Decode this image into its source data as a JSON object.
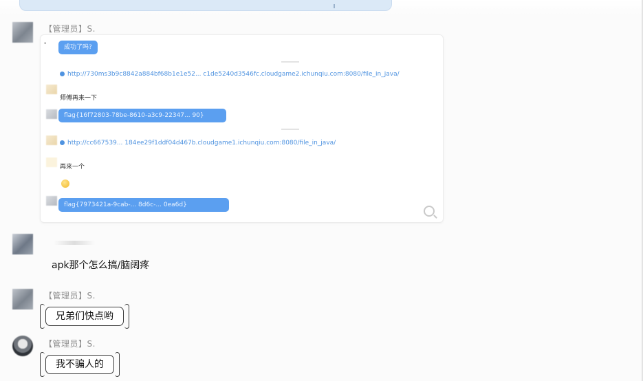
{
  "messages": [
    {
      "sender": "【管理员】S.",
      "embedded": {
        "bubble_1": "成功了吗?",
        "link_1": "http://730ms3b9c8842a884bf68b1e1e52... c1de5240d3546fc.cloudgame2.ichunqiu.com:8080/file_in_java/",
        "text_1": "师傅再来一下",
        "flag_1": "flag{16f72803-78be-8610-a3c9-22347... 90}",
        "link_2": "http://cc667539... 184ee29f1ddf04d467b.cloudgame1.ichunqiu.com:8080/file_in_java/",
        "text_2": "再来一个",
        "flag_2": "flag{7973421a-9cab-... 8d6c-... 0ea6d}"
      }
    },
    {
      "sender": "",
      "text": "apk那个怎么搞/脑阔疼"
    },
    {
      "sender": "【管理员】S.",
      "text": "兄弟们快点哟"
    },
    {
      "sender": "【管理员】S.",
      "text": "我不骗人的"
    }
  ],
  "icons": {
    "zoom": "zoom-in-icon",
    "link": "link-icon",
    "emoji": "smile-emoji-icon"
  },
  "colors": {
    "link_blue": "#4f93e0",
    "bubble_blue": "#5b9ff0"
  }
}
